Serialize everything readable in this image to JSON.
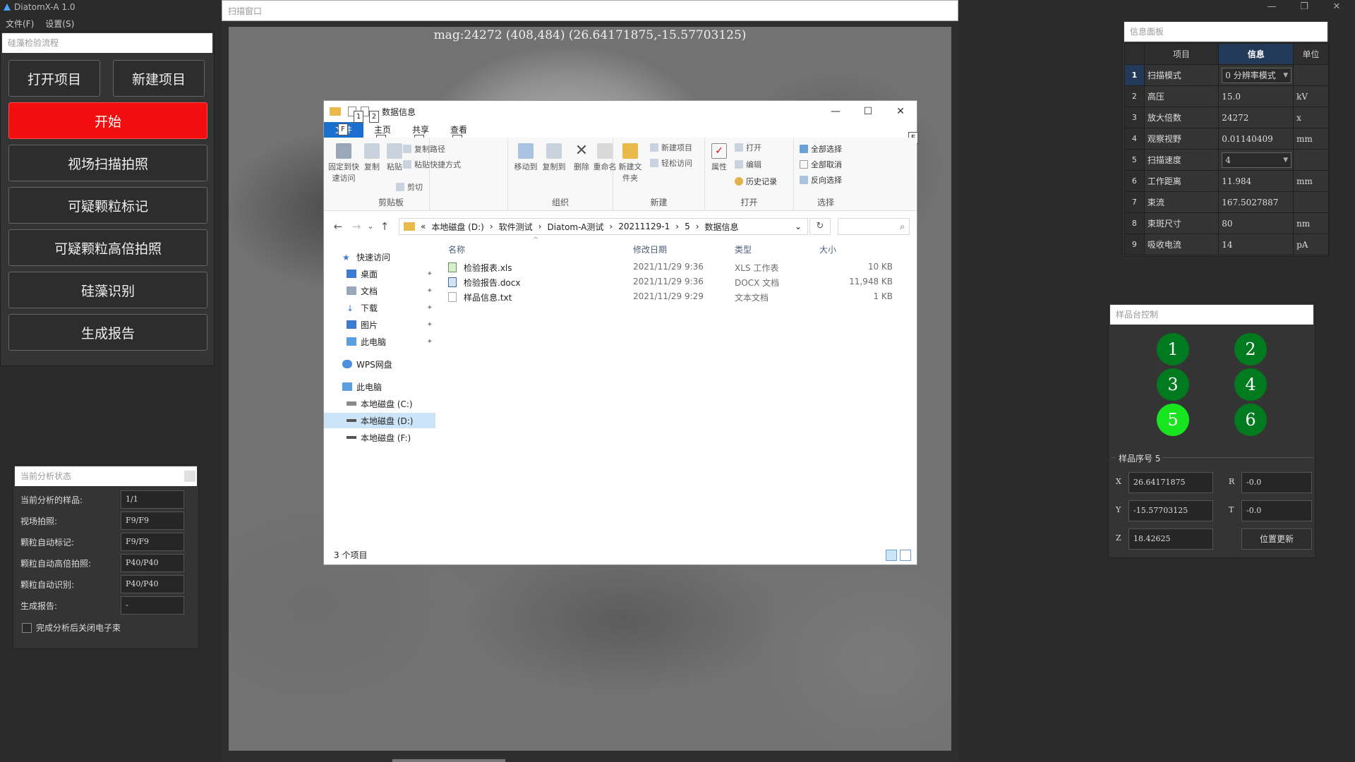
{
  "app": {
    "title": "DiatomX-A 1.0",
    "menu": [
      "文件(F)",
      "设置(S)"
    ],
    "window_controls": [
      "—",
      "❐",
      "✕"
    ]
  },
  "workflow": {
    "header": "硅藻检验流程",
    "open_project": "打开项目",
    "new_project": "新建项目",
    "start": "开始",
    "field_scan": "视场扫描拍照",
    "mark_particles": "可疑颗粒标记",
    "high_mag": "可疑颗粒高倍拍照",
    "identify": "硅藻识别",
    "report": "生成报告"
  },
  "status": {
    "header": "当前分析状态",
    "rows": [
      {
        "label": "当前分析的样品:",
        "value": "1/1"
      },
      {
        "label": "视场拍照:",
        "value": "F9/F9"
      },
      {
        "label": "颗粒自动标记:",
        "value": "F9/F9"
      },
      {
        "label": "颗粒自动高倍拍照:",
        "value": "P40/P40"
      },
      {
        "label": "颗粒自动识别:",
        "value": "P40/P40"
      },
      {
        "label": "生成报告:",
        "value": "-"
      }
    ],
    "checkbox_label": "完成分析后关闭电子束"
  },
  "scan": {
    "title": "扫描窗口",
    "overlay": "mag:24272 (408,484) (26.64171875,-15.57703125)"
  },
  "explorer": {
    "title": "数据信息",
    "window_controls": [
      "—",
      "☐",
      "✕"
    ],
    "tabs": [
      "文件",
      "主页",
      "共享",
      "查看"
    ],
    "keytips": [
      "1",
      "2",
      "F",
      "H",
      "S",
      "V",
      "E"
    ],
    "ribbon": {
      "pin": "固定到快速访问",
      "copy": "复制",
      "paste": "粘贴",
      "copy_path": "复制路径",
      "paste_shortcut": "粘贴快捷方式",
      "cut": "剪切",
      "clipboard": "剪贴板",
      "move_to": "移动到",
      "copy_to": "复制到",
      "delete": "删除",
      "rename": "重命名",
      "organize": "组织",
      "new_folder": "新建文件夹",
      "new_item": "新建项目",
      "easy_access": "轻松访问",
      "new": "新建",
      "properties": "属性",
      "open": "打开",
      "edit": "编辑",
      "history": "历史记录",
      "open_group": "打开",
      "select_all": "全部选择",
      "select_none": "全部取消",
      "invert": "反向选择",
      "select": "选择"
    },
    "nav_arrows": [
      "←",
      "→",
      "⌄",
      "↑"
    ],
    "address": [
      "«",
      "本地磁盘 (D:)",
      "›",
      "软件测试",
      "›",
      "Diatom-A测试",
      "›",
      "20211129-1",
      "›",
      "5",
      "›",
      "数据信息"
    ],
    "address_dropdown": "⌄",
    "refresh": "↻",
    "search_icon": "⌕",
    "nav": [
      {
        "label": "快速访问",
        "pinned": false
      },
      {
        "label": "桌面",
        "pinned": true
      },
      {
        "label": "文档",
        "pinned": true
      },
      {
        "label": "下载",
        "pinned": true
      },
      {
        "label": "图片",
        "pinned": true
      },
      {
        "label": "此电脑",
        "pinned": true
      },
      {
        "label": "WPS网盘",
        "pinned": false
      },
      {
        "label": "此电脑",
        "pinned": false
      },
      {
        "label": "本地磁盘 (C:)",
        "pinned": false
      },
      {
        "label": "本地磁盘 (D:)",
        "pinned": false
      },
      {
        "label": "本地磁盘 (F:)",
        "pinned": false
      }
    ],
    "pin_glyph": "✦",
    "columns": [
      "名称",
      "修改日期",
      "类型",
      "大小"
    ],
    "sort_glyph": "^",
    "files": [
      {
        "name": "检验报表.xls",
        "date": "2021/11/29 9:36",
        "type": "XLS 工作表",
        "size": "10 KB"
      },
      {
        "name": "检验报告.docx",
        "date": "2021/11/29 9:36",
        "type": "DOCX 文档",
        "size": "11,948 KB"
      },
      {
        "name": "样品信息.txt",
        "date": "2021/11/29 9:29",
        "type": "文本文档",
        "size": "1 KB"
      }
    ],
    "status": "3 个项目"
  },
  "info": {
    "header": "信息面板",
    "columns": [
      "项目",
      "信息",
      "单位"
    ],
    "rows": [
      {
        "num": "1",
        "name": "扫描模式",
        "value": "0 分辨率模式",
        "unit": "",
        "dropdown": true
      },
      {
        "num": "2",
        "name": "高压",
        "value": "15.0",
        "unit": "kV"
      },
      {
        "num": "3",
        "name": "放大倍数",
        "value": "24272",
        "unit": "x"
      },
      {
        "num": "4",
        "name": "观察视野",
        "value": "0.01140409",
        "unit": "mm"
      },
      {
        "num": "5",
        "name": "扫描速度",
        "value": "4",
        "unit": "",
        "dropdown": true
      },
      {
        "num": "6",
        "name": "工作距离",
        "value": "11.984",
        "unit": "mm"
      },
      {
        "num": "7",
        "name": "束流",
        "value": "167.5027887",
        "unit": ""
      },
      {
        "num": "8",
        "name": "束斑尺寸",
        "value": "80",
        "unit": "nm"
      },
      {
        "num": "9",
        "name": "吸收电流",
        "value": "14",
        "unit": "pA"
      }
    ],
    "dropdown_arrow": "▼"
  },
  "stage": {
    "header": "样品台控制",
    "positions": [
      "1",
      "2",
      "3",
      "4",
      "5",
      "6"
    ],
    "active_position": "5",
    "group_label": "样品序号 5",
    "axes": {
      "x_label": "X",
      "x": "26.64171875",
      "y_label": "Y",
      "y": "-15.57703125",
      "z_label": "Z",
      "z": "18.42625",
      "r_label": "R",
      "r": "-0.0",
      "t_label": "T",
      "t": "-0.0"
    },
    "update": "位置更新"
  },
  "colors": {
    "start_red": "#f20e0e",
    "stage_green": "#007a1f",
    "stage_active": "#17e61f",
    "header_blue": "#223a57",
    "file_tab_blue": "#1a6fcf"
  }
}
